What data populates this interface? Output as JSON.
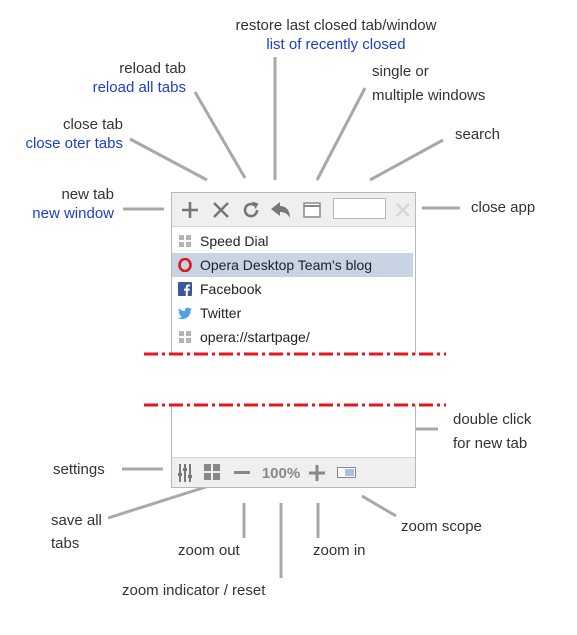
{
  "annotations": {
    "restore": {
      "label": "restore last closed tab/window",
      "alt": "list of recently closed"
    },
    "reload": {
      "label": "reload tab",
      "alt": "reload all tabs"
    },
    "windows": {
      "line1": "single or",
      "line2": "multiple windows"
    },
    "close_tab": {
      "label": "close tab",
      "alt": "close oter tabs"
    },
    "search": {
      "label": "search"
    },
    "new_tab": {
      "label": "new tab",
      "alt": "new window"
    },
    "close_app": {
      "label": "close app"
    },
    "double_click": {
      "line1": "double click",
      "line2": "for new tab"
    },
    "settings": {
      "label": "settings"
    },
    "save_all": {
      "line1": "save all",
      "line2": "tabs"
    },
    "zoom_scope": {
      "label": "zoom scope"
    },
    "zoom_out": {
      "label": "zoom out"
    },
    "zoom_in": {
      "label": "zoom in"
    },
    "zoom_indicator": {
      "label": "zoom indicator / reset"
    }
  },
  "tabs": [
    {
      "title": "Speed Dial",
      "icon": "speed-dial-icon"
    },
    {
      "title": "Opera Desktop Team's blog",
      "icon": "opera-icon",
      "active": true
    },
    {
      "title": "Facebook",
      "icon": "facebook-icon"
    },
    {
      "title": "Twitter",
      "icon": "twitter-icon"
    },
    {
      "title": "opera://startpage/",
      "icon": "speed-dial-icon"
    }
  ],
  "bottombar": {
    "zoom": "100%"
  },
  "colors": {
    "accent_text": "#1a3fc8",
    "cut_line": "#e8141c",
    "active_tab": "#c8d4e4",
    "callout_line": "#a8a8a8"
  }
}
